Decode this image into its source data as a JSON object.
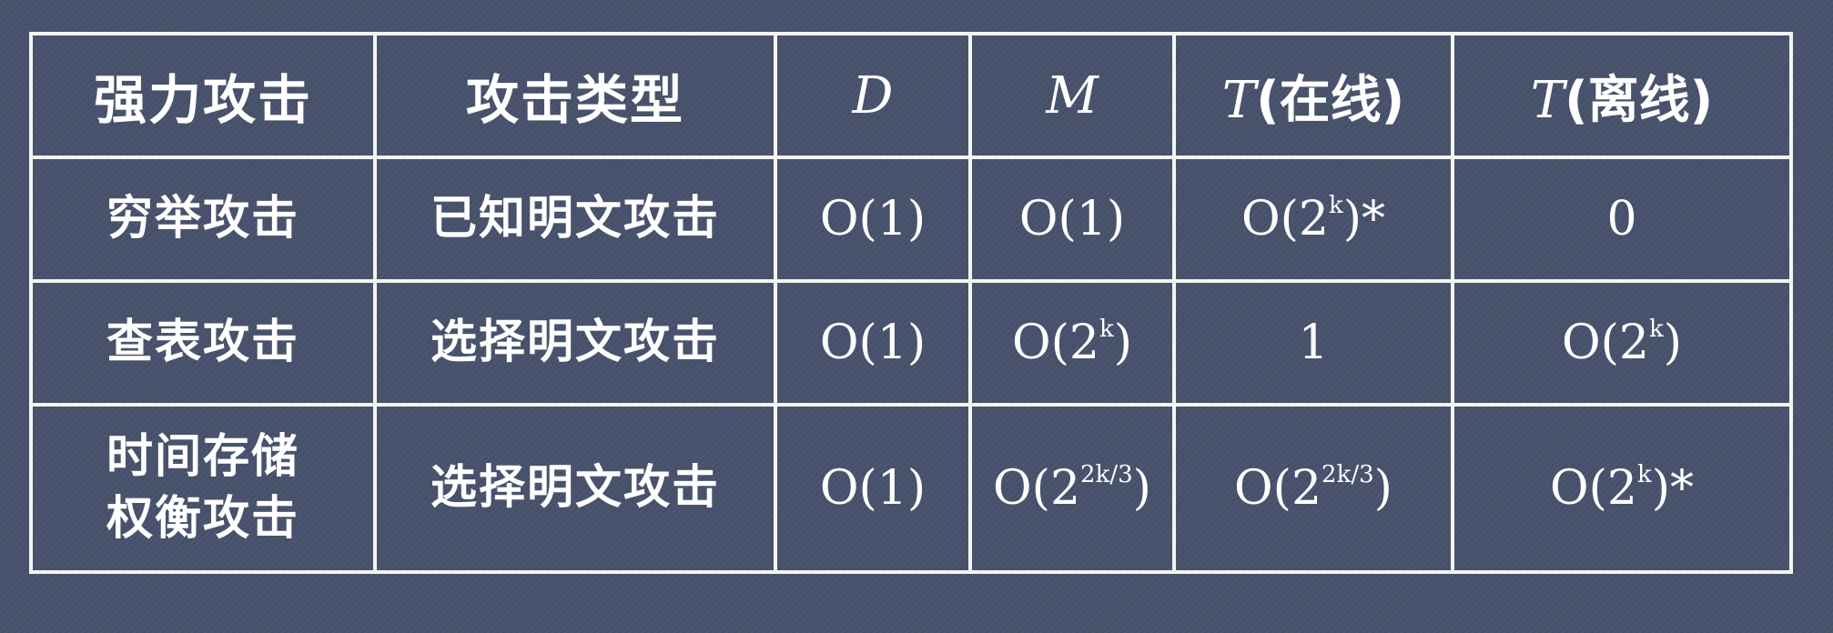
{
  "headers": {
    "attack": "强力攻击",
    "type": "攻击类型",
    "d": "D",
    "m": "M",
    "t_online_var": "T",
    "t_online_label": "(在线)",
    "t_offline_var": "T",
    "t_offline_label": "(离线)"
  },
  "rows": [
    {
      "attack": "穷举攻击",
      "type": "已知明文攻击",
      "d": "O(1)",
      "m": "O(1)",
      "t_online": {
        "base": "O(2",
        "exp": "k",
        "close": ")*"
      },
      "t_offline": "0"
    },
    {
      "attack": "查表攻击",
      "type": "选择明文攻击",
      "d": "O(1)",
      "m": {
        "base": "O(2",
        "exp": "k",
        "close": ")"
      },
      "t_online": "1",
      "t_offline": {
        "base": "O(2",
        "exp": "k",
        "close": ")"
      }
    },
    {
      "attack_line1": "时间存储",
      "attack_line2": "权衡攻击",
      "type": "选择明文攻击",
      "d": "O(1)",
      "m": {
        "base": "O(2",
        "exp": "2k/3",
        "close": ")"
      },
      "t_online": {
        "base": "O(2",
        "exp": "2k/3",
        "close": ")"
      },
      "t_offline": {
        "base": "O(2",
        "exp": "k",
        "close": ")*"
      }
    }
  ],
  "colors": {
    "background": "#46506a",
    "border": "#f4f4f4",
    "text": "#ffffff"
  }
}
